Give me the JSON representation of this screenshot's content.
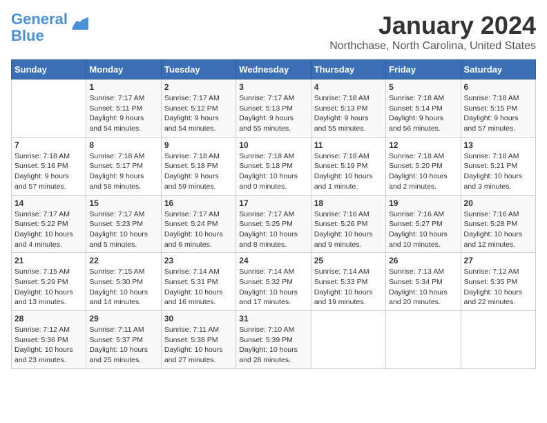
{
  "logo": {
    "line1": "General",
    "line2": "Blue"
  },
  "title": "January 2024",
  "location": "Northchase, North Carolina, United States",
  "weekdays": [
    "Sunday",
    "Monday",
    "Tuesday",
    "Wednesday",
    "Thursday",
    "Friday",
    "Saturday"
  ],
  "weeks": [
    [
      {
        "day": "",
        "info": ""
      },
      {
        "day": "1",
        "info": "Sunrise: 7:17 AM\nSunset: 5:11 PM\nDaylight: 9 hours\nand 54 minutes."
      },
      {
        "day": "2",
        "info": "Sunrise: 7:17 AM\nSunset: 5:12 PM\nDaylight: 9 hours\nand 54 minutes."
      },
      {
        "day": "3",
        "info": "Sunrise: 7:17 AM\nSunset: 5:13 PM\nDaylight: 9 hours\nand 55 minutes."
      },
      {
        "day": "4",
        "info": "Sunrise: 7:18 AM\nSunset: 5:13 PM\nDaylight: 9 hours\nand 55 minutes."
      },
      {
        "day": "5",
        "info": "Sunrise: 7:18 AM\nSunset: 5:14 PM\nDaylight: 9 hours\nand 56 minutes."
      },
      {
        "day": "6",
        "info": "Sunrise: 7:18 AM\nSunset: 5:15 PM\nDaylight: 9 hours\nand 57 minutes."
      }
    ],
    [
      {
        "day": "7",
        "info": "Sunrise: 7:18 AM\nSunset: 5:16 PM\nDaylight: 9 hours\nand 57 minutes."
      },
      {
        "day": "8",
        "info": "Sunrise: 7:18 AM\nSunset: 5:17 PM\nDaylight: 9 hours\nand 58 minutes."
      },
      {
        "day": "9",
        "info": "Sunrise: 7:18 AM\nSunset: 5:18 PM\nDaylight: 9 hours\nand 59 minutes."
      },
      {
        "day": "10",
        "info": "Sunrise: 7:18 AM\nSunset: 5:18 PM\nDaylight: 10 hours\nand 0 minutes."
      },
      {
        "day": "11",
        "info": "Sunrise: 7:18 AM\nSunset: 5:19 PM\nDaylight: 10 hours\nand 1 minute."
      },
      {
        "day": "12",
        "info": "Sunrise: 7:18 AM\nSunset: 5:20 PM\nDaylight: 10 hours\nand 2 minutes."
      },
      {
        "day": "13",
        "info": "Sunrise: 7:18 AM\nSunset: 5:21 PM\nDaylight: 10 hours\nand 3 minutes."
      }
    ],
    [
      {
        "day": "14",
        "info": "Sunrise: 7:17 AM\nSunset: 5:22 PM\nDaylight: 10 hours\nand 4 minutes."
      },
      {
        "day": "15",
        "info": "Sunrise: 7:17 AM\nSunset: 5:23 PM\nDaylight: 10 hours\nand 5 minutes."
      },
      {
        "day": "16",
        "info": "Sunrise: 7:17 AM\nSunset: 5:24 PM\nDaylight: 10 hours\nand 6 minutes."
      },
      {
        "day": "17",
        "info": "Sunrise: 7:17 AM\nSunset: 5:25 PM\nDaylight: 10 hours\nand 8 minutes."
      },
      {
        "day": "18",
        "info": "Sunrise: 7:16 AM\nSunset: 5:26 PM\nDaylight: 10 hours\nand 9 minutes."
      },
      {
        "day": "19",
        "info": "Sunrise: 7:16 AM\nSunset: 5:27 PM\nDaylight: 10 hours\nand 10 minutes."
      },
      {
        "day": "20",
        "info": "Sunrise: 7:16 AM\nSunset: 5:28 PM\nDaylight: 10 hours\nand 12 minutes."
      }
    ],
    [
      {
        "day": "21",
        "info": "Sunrise: 7:15 AM\nSunset: 5:29 PM\nDaylight: 10 hours\nand 13 minutes."
      },
      {
        "day": "22",
        "info": "Sunrise: 7:15 AM\nSunset: 5:30 PM\nDaylight: 10 hours\nand 14 minutes."
      },
      {
        "day": "23",
        "info": "Sunrise: 7:14 AM\nSunset: 5:31 PM\nDaylight: 10 hours\nand 16 minutes."
      },
      {
        "day": "24",
        "info": "Sunrise: 7:14 AM\nSunset: 5:32 PM\nDaylight: 10 hours\nand 17 minutes."
      },
      {
        "day": "25",
        "info": "Sunrise: 7:14 AM\nSunset: 5:33 PM\nDaylight: 10 hours\nand 19 minutes."
      },
      {
        "day": "26",
        "info": "Sunrise: 7:13 AM\nSunset: 5:34 PM\nDaylight: 10 hours\nand 20 minutes."
      },
      {
        "day": "27",
        "info": "Sunrise: 7:12 AM\nSunset: 5:35 PM\nDaylight: 10 hours\nand 22 minutes."
      }
    ],
    [
      {
        "day": "28",
        "info": "Sunrise: 7:12 AM\nSunset: 5:36 PM\nDaylight: 10 hours\nand 23 minutes."
      },
      {
        "day": "29",
        "info": "Sunrise: 7:11 AM\nSunset: 5:37 PM\nDaylight: 10 hours\nand 25 minutes."
      },
      {
        "day": "30",
        "info": "Sunrise: 7:11 AM\nSunset: 5:38 PM\nDaylight: 10 hours\nand 27 minutes."
      },
      {
        "day": "31",
        "info": "Sunrise: 7:10 AM\nSunset: 5:39 PM\nDaylight: 10 hours\nand 28 minutes."
      },
      {
        "day": "",
        "info": ""
      },
      {
        "day": "",
        "info": ""
      },
      {
        "day": "",
        "info": ""
      }
    ]
  ]
}
